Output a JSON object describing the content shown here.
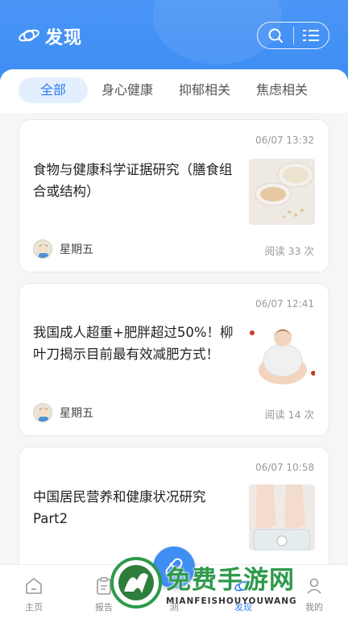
{
  "header": {
    "title": "发现",
    "logo_icon": "planet-logo-icon",
    "search_icon": "search-icon",
    "menu_icon": "list-menu-icon"
  },
  "tabs": [
    {
      "label": "全部",
      "active": true
    },
    {
      "label": "身心健康",
      "active": false
    },
    {
      "label": "抑郁相关",
      "active": false
    },
    {
      "label": "焦虑相关",
      "active": false
    }
  ],
  "articles": [
    {
      "time": "06/07 13:32",
      "title": "食物与健康科学证据研究（膳食组合或结构）",
      "author": "星期五",
      "reads": "阅读 33 次",
      "thumb": "food-bowls-image"
    },
    {
      "time": "06/07 12:41",
      "title": "我国成人超重+肥胖超过50%！柳叶刀揭示目前最有效减肥方式！",
      "author": "星期五",
      "reads": "阅读 14 次",
      "thumb": "overweight-woman-image"
    },
    {
      "time": "06/07 10:58",
      "title": "中国居民营养和健康状况研究Part2",
      "author": "",
      "reads": "",
      "thumb": "feet-on-scale-image"
    }
  ],
  "bottom_nav": [
    {
      "label": "主页",
      "icon": "home-icon",
      "active": false
    },
    {
      "label": "报告",
      "icon": "report-icon",
      "active": false
    },
    {
      "label": "测",
      "icon": "test-icon",
      "active": false
    },
    {
      "label": "发现",
      "icon": "discover-icon",
      "active": true
    },
    {
      "label": "我的",
      "icon": "profile-icon",
      "active": false
    }
  ],
  "fab_icon": "capsule-icon",
  "watermark": {
    "title": "免费手游网",
    "subtitle": "MIANFEISHOUYOUWANG"
  },
  "colors": {
    "primary": "#3f8ef4",
    "accent": "#2e7df0",
    "watermark_green": "#2e9a4a"
  }
}
